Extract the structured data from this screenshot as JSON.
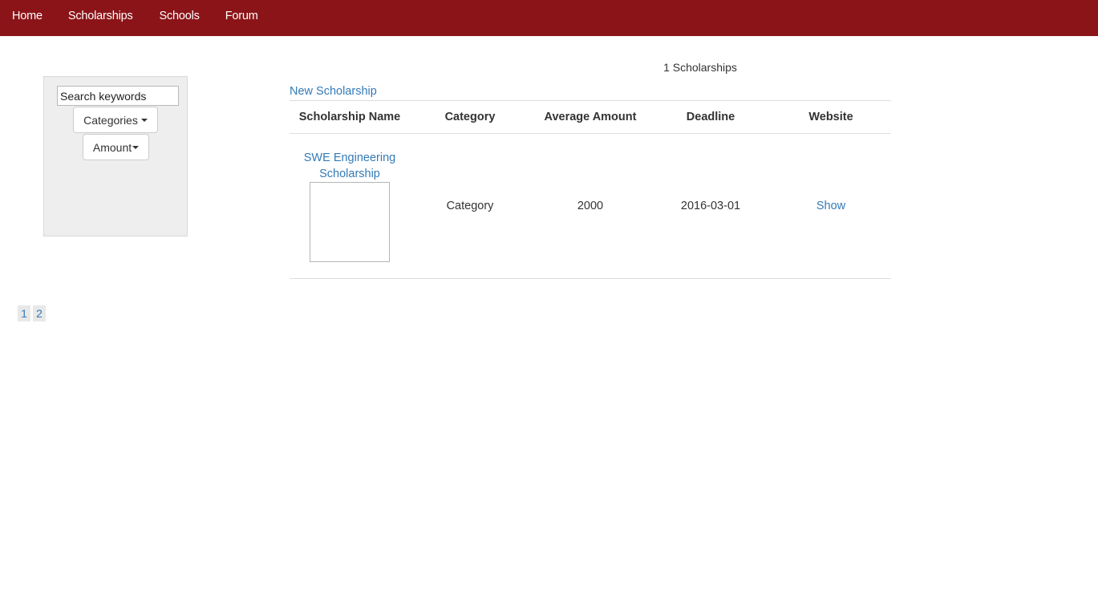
{
  "nav": {
    "items": [
      {
        "label": "Home"
      },
      {
        "label": "Scholarships"
      },
      {
        "label": "Schools"
      },
      {
        "label": "Forum"
      }
    ],
    "background": "#8b1418"
  },
  "sidebar": {
    "search": {
      "value": "Search keywords",
      "placeholder": "Search keywords"
    },
    "categories_label": "Categories",
    "amount_label": "Amount"
  },
  "main": {
    "count_text": "1 Scholarships",
    "new_link": "New Scholarship",
    "table": {
      "headers": [
        "Scholarship Name",
        "Category",
        "Average Amount",
        "Deadline",
        "Website"
      ],
      "rows": [
        {
          "name": "SWE Engineering Scholarship",
          "category": "Category",
          "average_amount": "2000",
          "deadline": "2016-03-01",
          "website_link": "Show"
        }
      ]
    }
  },
  "pagination": {
    "pages": [
      "1",
      "2"
    ]
  },
  "colors": {
    "link": "#337ab7",
    "sidebar_bg": "#eeeeee"
  }
}
